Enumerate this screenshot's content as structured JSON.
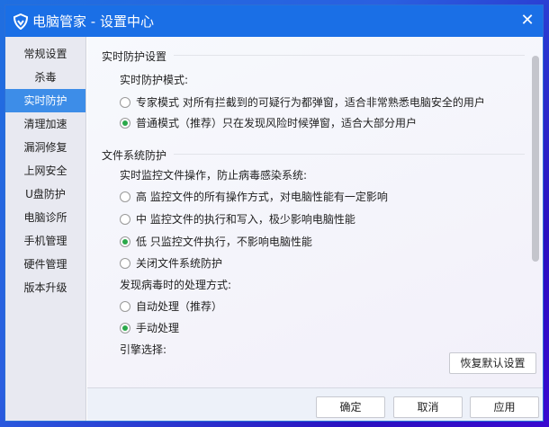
{
  "window": {
    "title": "电脑管家 - 设置中心",
    "close": "✕"
  },
  "sidebar": {
    "items": [
      {
        "label": "常规设置"
      },
      {
        "label": "杀毒"
      },
      {
        "label": "实时防护",
        "selected": true
      },
      {
        "label": "清理加速"
      },
      {
        "label": "漏洞修复"
      },
      {
        "label": "上网安全"
      },
      {
        "label": "U盘防护"
      },
      {
        "label": "电脑诊所"
      },
      {
        "label": "手机管理"
      },
      {
        "label": "硬件管理"
      },
      {
        "label": "版本升级"
      }
    ]
  },
  "content": {
    "section1": {
      "title": "实时防护设置",
      "label": "实时防护模式:",
      "options": [
        {
          "label": "专家模式  对所有拦截到的可疑行为都弹窗，适合非常熟悉电脑安全的用户",
          "checked": false
        },
        {
          "label": "普通模式（推荐）只在发现风险时候弹窗，适合大部分用户",
          "checked": true
        }
      ]
    },
    "section2": {
      "title": "文件系统防护",
      "label": "实时监控文件操作，防止病毒感染系统:",
      "options": [
        {
          "label": "高   监控文件的所有操作方式，对电脑性能有一定影响",
          "checked": false
        },
        {
          "label": "中   监控文件的执行和写入，极少影响电脑性能",
          "checked": false
        },
        {
          "label": "低   只监控文件执行，不影响电脑性能",
          "checked": true
        },
        {
          "label": "关闭文件系统防护",
          "checked": false
        }
      ],
      "virus_label": "发现病毒时的处理方式:",
      "virus_options": [
        {
          "label": "自动处理（推荐）",
          "checked": false
        },
        {
          "label": "手动处理",
          "checked": true
        }
      ],
      "engine_label": "引擎选择:"
    },
    "restore_label": "恢复默认设置"
  },
  "footer": {
    "ok": "确定",
    "cancel": "取消",
    "apply": "应用"
  }
}
